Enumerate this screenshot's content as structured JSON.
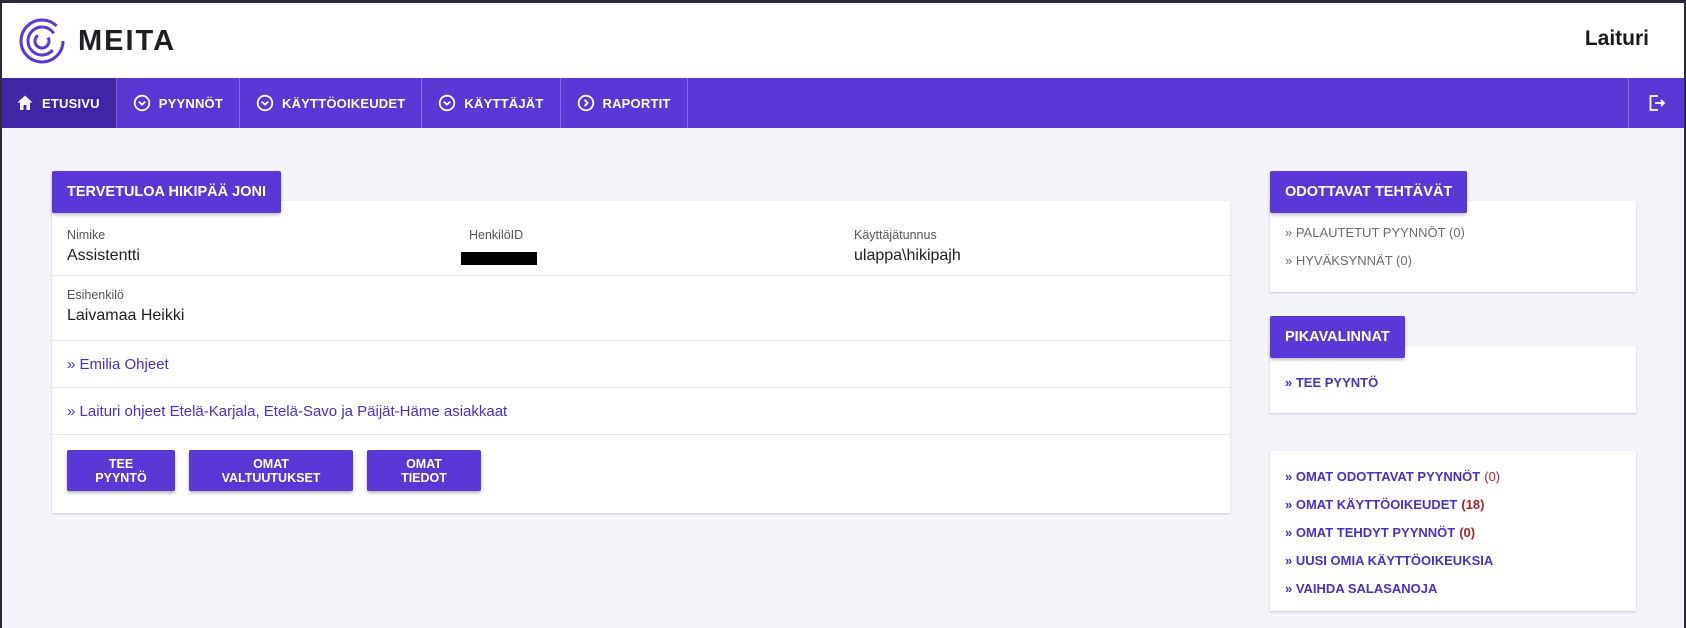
{
  "header": {
    "logo_text": "MEITA",
    "app_title": "Laituri",
    "brand_color": "#5a38d6"
  },
  "nav": {
    "items": [
      {
        "label": "ETUSIVU",
        "icon": "home-icon",
        "active": true
      },
      {
        "label": "PYYNNÖT",
        "icon": "chevron-down-circle-icon"
      },
      {
        "label": "KÄYTTÖOIKEUDET",
        "icon": "chevron-down-circle-icon"
      },
      {
        "label": "KÄYTTÄJÄT",
        "icon": "chevron-down-circle-icon"
      },
      {
        "label": "RAPORTIT",
        "icon": "chevron-right-circle-icon"
      }
    ],
    "logout_icon": "logout-icon"
  },
  "welcome": {
    "title": "TERVETULOA HIKIPÄÄ JONI",
    "nimike_label": "Nimike",
    "nimike_value": "Assistentti",
    "henkiloid_label": "HenkilöID",
    "kayttajatunnus_label": "Käyttäjätunnus",
    "kayttajatunnus_value": "ulappa\\hikipajh",
    "esihenkilo_label": "Esihenkilö",
    "esihenkilo_value": "Laivamaa Heikki",
    "links": [
      "» Emilia Ohjeet",
      "» Laituri ohjeet Etelä-Karjala, Etelä-Savo ja Päijät-Häme asiakkaat"
    ],
    "buttons": [
      "TEE PYYNTÖ",
      "OMAT VALTUUTUKSET",
      "OMAT TIEDOT"
    ]
  },
  "pending": {
    "title": "ODOTTAVAT TEHTÄVÄT",
    "items": [
      "» PALAUTETUT PYYNNÖT (0)",
      "» HYVÄKSYNNÄT (0)"
    ]
  },
  "quick": {
    "title": "PIKAVALINNAT",
    "items": [
      "» TEE PYYNTÖ"
    ]
  },
  "own": {
    "items": [
      {
        "label": "» OMAT ODOTTAVAT PYYNNÖT",
        "count": "(0)"
      },
      {
        "label": "» OMAT KÄYTTÖOIKEUDET",
        "count": "(18)"
      },
      {
        "label": "» OMAT TEHDYT PYYNNÖT",
        "count": "(0)"
      },
      {
        "label": "» UUSI OMIA KÄYTTÖOIKEUKSIA"
      },
      {
        "label": "» VAIHDA SALASANOJA"
      }
    ]
  }
}
